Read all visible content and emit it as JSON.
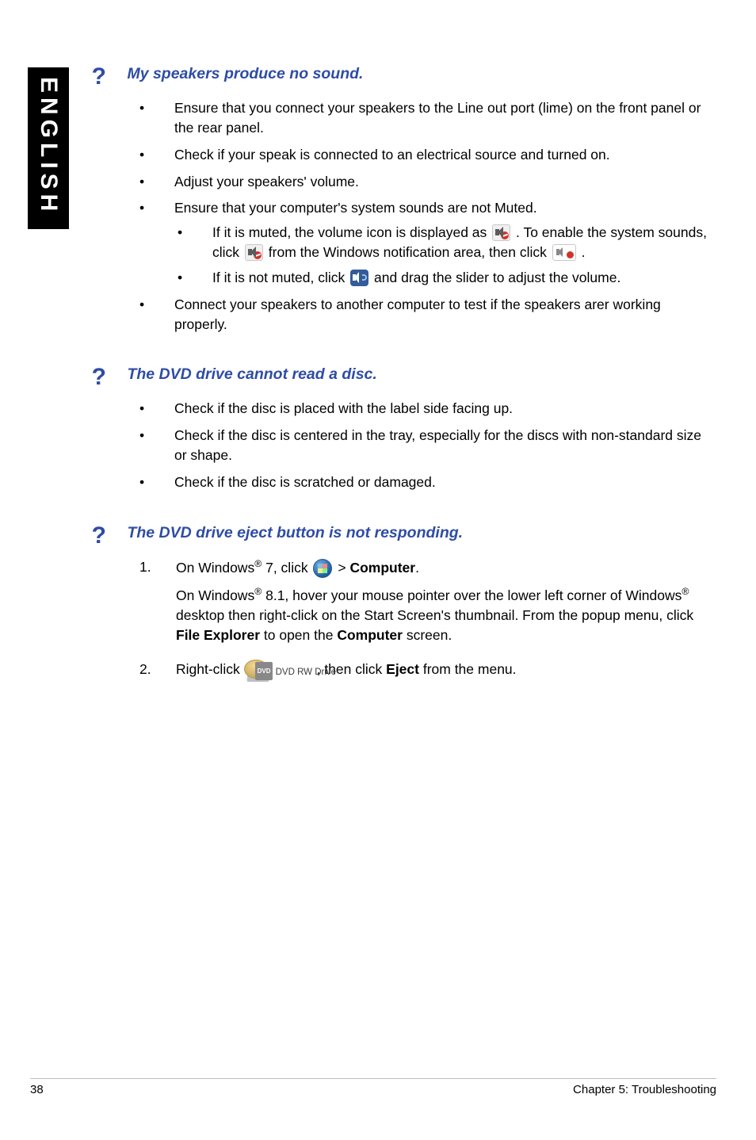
{
  "sidebar": {
    "label": "ENGLISH"
  },
  "q_mark": "?",
  "sections": [
    {
      "title": "My speakers produce no sound.",
      "items": [
        "Ensure that you connect your speakers to the Line out port (lime) on the front panel or the rear panel.",
        "Check if your speak is connected to an electrical source and turned on.",
        "Adjust your speakers' volume.",
        "Ensure that your computer's system sounds are not Muted.",
        "Connect your speakers to another computer to test if the speakers arer working properly."
      ],
      "sub": {
        "a_pre": "If it is muted, the volume icon is displayed as",
        "a_mid": ". To enable the system sounds, click",
        "a_mid2": "from the Windows notification area, then click",
        "a_end": ".",
        "b_pre": "If it is not muted, click",
        "b_end": "and drag the slider to adjust the volume."
      }
    },
    {
      "title": "The DVD drive cannot read a disc.",
      "items": [
        "Check if the disc is placed with the label side facing up.",
        "Check if the disc is centered in the tray, especially for the discs with non-standard size or shape.",
        "Check if the disc is scratched or damaged."
      ]
    },
    {
      "title": "The DVD drive eject button is not responding.",
      "step1_pre": "On Windows",
      "step1_ver": " 7, click",
      "step1_gt": " >",
      "step1_comp": "Computer",
      "step1_dot": ".",
      "step1_81a": "On Windows",
      "step1_81b": " 8.1, hover your mouse pointer over the lower left corner of Windows",
      "step1_81c": " desktop then right-click on the Start Screen's thumbnail. From the popup menu, click ",
      "step1_fe": "File Explorer",
      "step1_open": " to open the ",
      "step1_comp2": "Computer",
      "step1_screen": " screen.",
      "step2_pre": "Right-click",
      "step2_mid": ", then click ",
      "step2_ej": "Eject",
      "step2_end": " from the menu.",
      "drive_label": "DVD RW Drive",
      "dvd_badge": "DVD"
    }
  ],
  "numbers": [
    "1.",
    "2."
  ],
  "reg": "®",
  "footer": {
    "page": "38",
    "chapter": "Chapter 5: Troubleshooting"
  }
}
